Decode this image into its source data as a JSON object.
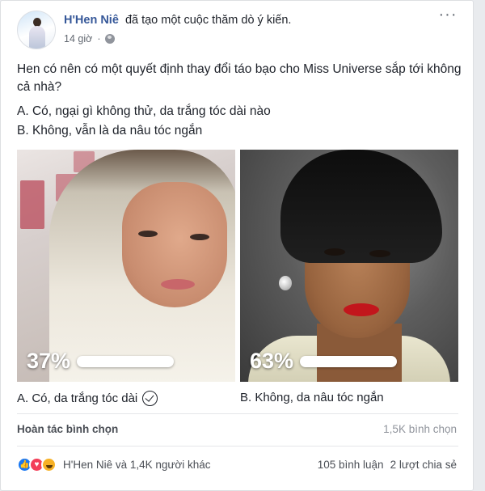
{
  "post": {
    "author": "H'Hen Niê",
    "action": "đã tạo một cuộc thăm dò ý kiến.",
    "time": "14 giờ",
    "menu": "···",
    "question": "Hen có nên có một quyết định thay đổi táo bạo cho Miss Universe sắp tới không cả nhà?",
    "option_a_line": "A. Có, ngại gì không thử, da trắng tóc dài nào",
    "option_b_line": "B. Không, vẫn là da nâu tóc ngắn"
  },
  "poll": {
    "options": [
      {
        "label": "A. Có, da trắng tóc dài",
        "percent_text": "37%",
        "percent": 37,
        "selected": true
      },
      {
        "label": "B. Không, da nâu tóc ngắn",
        "percent_text": "63%",
        "percent": 63,
        "selected": false
      }
    ],
    "undo_label": "Hoàn tác bình chọn",
    "total_votes": "1,5K bình chọn"
  },
  "footer": {
    "reactions": [
      "like-icon",
      "love-icon",
      "haha-icon"
    ],
    "reaction_names": "H'Hen Niê và 1,4K người khác",
    "comments": "105 bình luận",
    "shares": "2 lượt chia sẻ"
  },
  "colors": {
    "link": "#365899",
    "like": "#1877f2",
    "love": "#f33e58",
    "haha": "#f7b125",
    "secondary_text": "#90949c"
  }
}
